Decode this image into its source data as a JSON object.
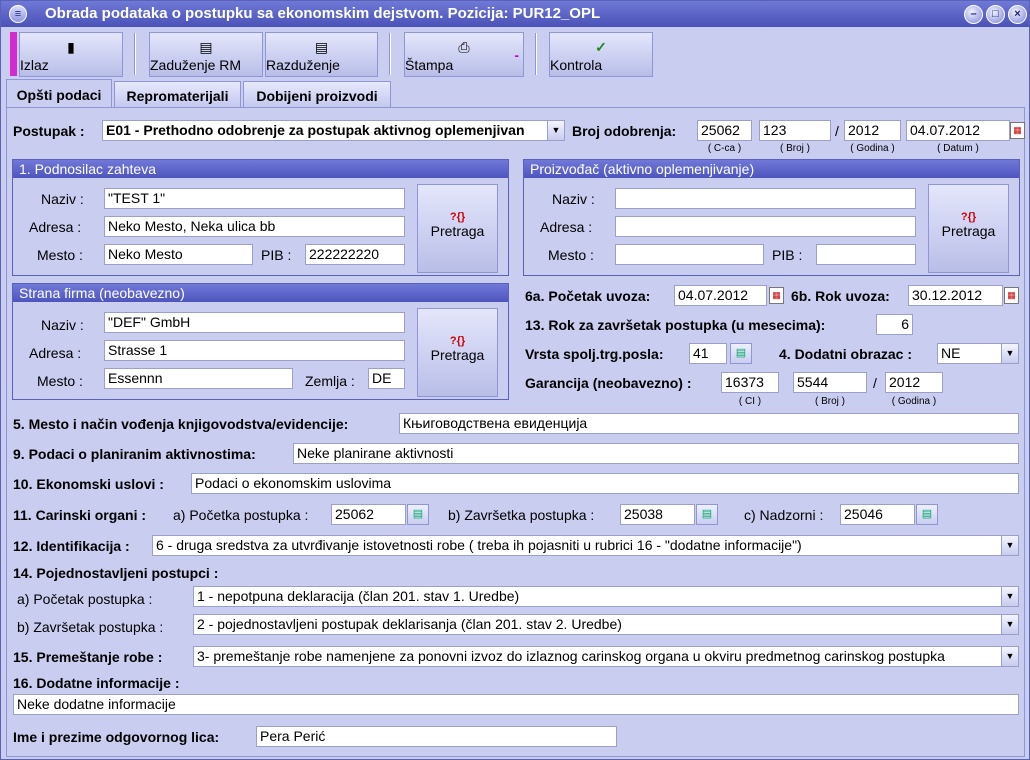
{
  "window": {
    "title": "Obrada podataka o postupku sa ekonomskim dejstvom. Pozicija: PUR12_OPL"
  },
  "toolbar": {
    "izlaz": "Izlaz",
    "zaduzenje": "Zaduženje RM",
    "razduzenje": "Razduženje",
    "stampa": "Štampa",
    "kontrola": "Kontrola"
  },
  "tabs": [
    "Opšti podaci",
    "Repromaterijali",
    "Dobijeni proizvodi"
  ],
  "postupak": {
    "label": "Postupak :",
    "value": "E01 - Prethodno odobrenje za postupak aktivnog oplemenjivan",
    "broj_label": "Broj odobrenja:",
    "ccca": "25062",
    "broj": "123",
    "godina": "2012",
    "datum": "04.07.2012",
    "cap_ccca": "( C-ca )",
    "cap_broj": "( Broj )",
    "cap_godina": "( Godina )",
    "cap_datum": "( Datum )",
    "slash": "/"
  },
  "podnosilac": {
    "title": "1. Podnosilac zahteva",
    "naziv_label": "Naziv :",
    "naziv": "\"TEST 1\"",
    "adresa_label": "Adresa :",
    "adresa": "Neko Mesto, Neka ulica bb",
    "mesto_label": "Mesto :",
    "mesto": "Neko Mesto",
    "pib_label": "PIB :",
    "pib": "222222220",
    "pretraga": "Pretraga"
  },
  "proizvodjac": {
    "title": "Proizvođač (aktivno oplemenjivanje)",
    "naziv_label": "Naziv :",
    "adresa_label": "Adresa :",
    "mesto_label": "Mesto :",
    "pib_label": "PIB :",
    "pretraga": "Pretraga"
  },
  "strana": {
    "title": "Strana firma (neobavezno)",
    "naziv_label": "Naziv :",
    "naziv": "\"DEF\" GmbH",
    "adresa_label": "Adresa :",
    "adresa": "Strasse 1",
    "mesto_label": "Mesto :",
    "mesto": "Essennn",
    "zemlja_label": "Zemlja :",
    "zemlja": "DE",
    "pretraga": "Pretraga"
  },
  "uvoz": {
    "pocetak_label": "6a. Početak uvoza:",
    "pocetak": "04.07.2012",
    "rok_label": "6b. Rok uvoza:",
    "rok": "30.12.2012",
    "zavrsetak_label": "13. Rok za završetak postupka (u mesecima):",
    "zavrsetak": "6",
    "vrsta_label": "Vrsta spolj.trg.posla:",
    "vrsta": "41",
    "dodatni_label": "4. Dodatni obrazac :",
    "dodatni": "NE",
    "garancija_label": "Garancija (neobavezno) :",
    "g_ci": "16373",
    "g_broj": "5544",
    "g_godina": "2012",
    "cap_ci": "( CI )",
    "cap_broj": "( Broj )",
    "cap_godina": "( Godina )",
    "slash": "/"
  },
  "f5": {
    "label": "5. Mesto i način vođenja knjigovodstva/evidencije:",
    "value": "Књиговодствена евиденција"
  },
  "f9": {
    "label": "9. Podaci o planiranim aktivnostima:",
    "value": "Neke planirane aktivnosti"
  },
  "f10": {
    "label": "10. Ekonomski uslovi :",
    "value": "Podaci o ekonomskim uslovima"
  },
  "f11": {
    "label": "11. Carinski organi :",
    "a_label": "a) Početka postupka :",
    "a": "25062",
    "b_label": "b) Završetka postupka :",
    "b": "25038",
    "c_label": "c) Nadzorni :",
    "c": "25046"
  },
  "f12": {
    "label": "12. Identifikacija :",
    "value": "6 - druga sredstva za utvrđivanje istovetnosti robe ( treba  ih pojasniti u rubrici 16 - \"dodatne  informacije\")"
  },
  "f14": {
    "label": "14. Pojednostavljeni postupci :",
    "a_label": "a) Početak postupka :",
    "a": "1 - nepotpuna deklaracija (član 201. stav 1. Uredbe)",
    "b_label": "b) Završetak postupka :",
    "b": "2 - pojednostavljeni postupak deklarisanja (član 201. stav 2. Uredbe)"
  },
  "f15": {
    "label": "15. Premeštanje robe :",
    "value": "3-  premeštanje robe namenjene za ponovni izvoz do izlaznog carinskog organa u okviru predmetnog carinskog postupka"
  },
  "f16": {
    "label": "16. Dodatne informacije :",
    "value": "Neke dodatne informacije"
  },
  "odgovorni": {
    "label": "Ime i prezime odgovornog lica:",
    "value": "Pera Perić"
  }
}
